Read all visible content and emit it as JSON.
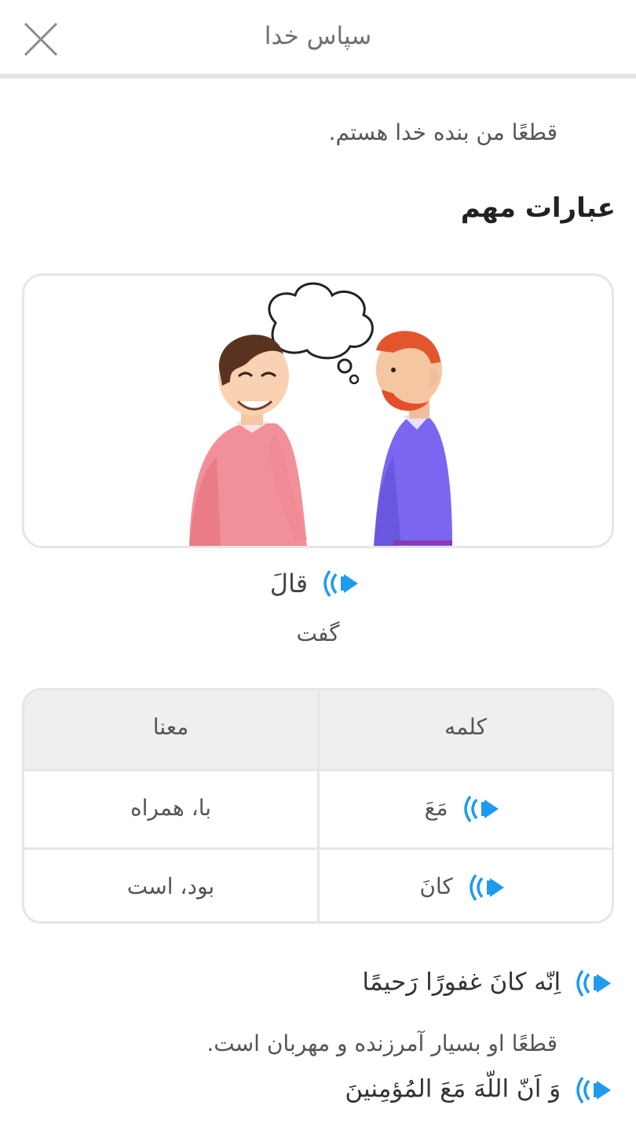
{
  "header": {
    "title": "سپاس خدا",
    "close_icon": "close-icon"
  },
  "intro_line": "قطعًا من بنده خدا هستم.",
  "section_title": "عبارات مهم",
  "featured_word": {
    "arabic": "قالَ",
    "meaning": "گفت"
  },
  "table": {
    "headers": [
      "معنا",
      "کلمه"
    ],
    "rows": [
      {
        "word": "مَعَ",
        "meaning": "با، همراه"
      },
      {
        "word": "کانَ",
        "meaning": "بود، است"
      }
    ]
  },
  "verses": [
    {
      "arabic": "اِنّه کانَ غفورًا رَحیمًا",
      "translation": "قطعًا او بسیار آمرزنده و مهربان است."
    },
    {
      "arabic": "وَ اَنّ اللّهَ مَعَ المُؤمِنینَ",
      "translation": ""
    }
  ],
  "colors": {
    "accent": "#1E9BEF",
    "border": "#E6E6E6",
    "table_header_bg": "#EFEFEF"
  }
}
